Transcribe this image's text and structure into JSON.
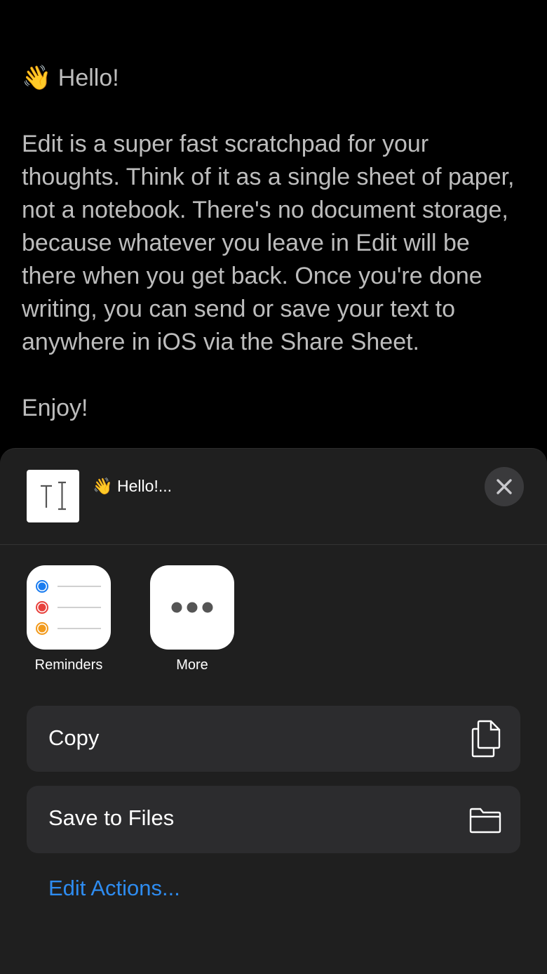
{
  "editor": {
    "greeting": "👋 Hello!",
    "body": "Edit is a super fast scratchpad for your thoughts. Think of it as a single sheet of paper, not a notebook. There's no document storage, because whatever you leave in Edit will be there when you get back. Once you're done writing, you can send or save your text to anywhere in iOS via the Share Sheet.",
    "closing": "Enjoy!"
  },
  "share_sheet": {
    "preview_title": "👋 Hello!...",
    "apps": [
      {
        "label": "Reminders",
        "icon": "reminders-icon"
      },
      {
        "label": "More",
        "icon": "more-icon"
      }
    ],
    "actions": [
      {
        "label": "Copy",
        "icon": "copy-icon"
      },
      {
        "label": "Save to Files",
        "icon": "folder-icon"
      }
    ],
    "edit_actions_label": "Edit Actions..."
  },
  "colors": {
    "background": "#000000",
    "sheet": "#1f1f1f",
    "action_bg": "#2c2c2e",
    "link": "#2e8cf0",
    "reminder_blue": "#1a7cf0",
    "reminder_red": "#e8413c",
    "reminder_orange": "#f29a1c"
  }
}
